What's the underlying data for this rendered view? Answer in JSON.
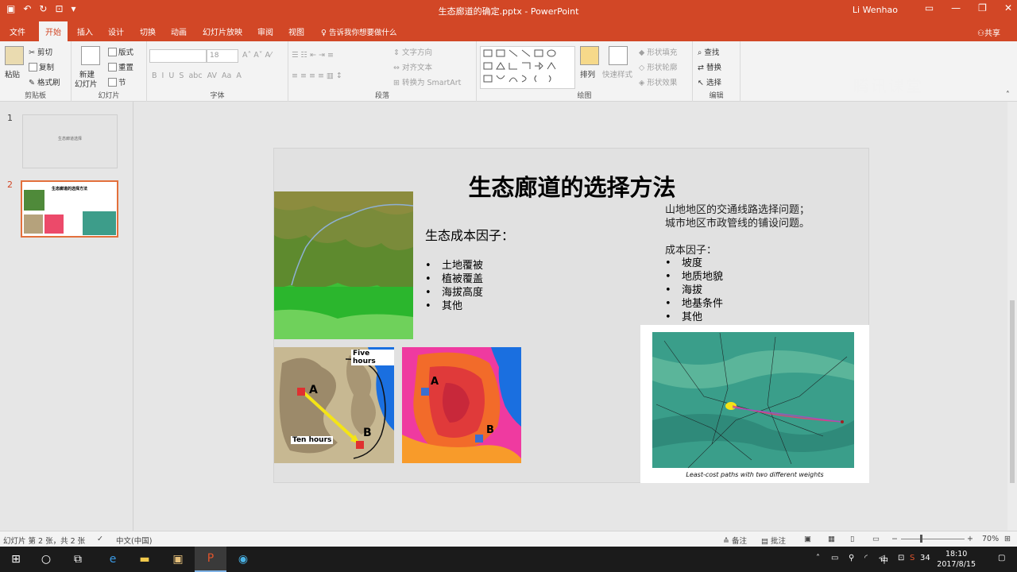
{
  "window": {
    "title": "生态廊道的确定.pptx - PowerPoint",
    "user": "Li Wenhao",
    "watermark": "腾讯课堂"
  },
  "ribbon_tabs": [
    "文件",
    "开始",
    "插入",
    "设计",
    "切换",
    "动画",
    "幻灯片放映",
    "审阅",
    "视图"
  ],
  "tell_me": "告诉我你想要做什么",
  "share": "共享",
  "clipboard": {
    "paste": "粘贴",
    "cut": "剪切",
    "copy": "复制",
    "painter": "格式刷",
    "label": "剪贴板"
  },
  "slides_group": {
    "new": "新建",
    "new2": "幻灯片",
    "layout": "版式",
    "reset": "重置",
    "section": "节",
    "label": "幻灯片"
  },
  "font_group": {
    "size": "18",
    "label": "字体"
  },
  "paragraph_group": {
    "text_dir": "文字方向",
    "align": "对齐文本",
    "smartart": "转换为 SmartArt",
    "label": "段落"
  },
  "drawing_group": {
    "arrange": "排列",
    "quick_styles": "快速样式",
    "fill": "形状填充",
    "outline": "形状轮廓",
    "effect": "形状效果",
    "label": "绘图"
  },
  "editing_group": {
    "find": "查找",
    "replace": "替换",
    "select": "选择",
    "label": "编辑"
  },
  "thumbs": [
    {
      "num": "1",
      "text": "生态廊道选择"
    },
    {
      "num": "2",
      "text": "生态廊道的选择方法"
    }
  ],
  "slide": {
    "title": "生态廊道的选择方法",
    "heading": "生态成本因子：",
    "left_list": [
      "土地覆被",
      "植被覆盖",
      "海拔高度",
      "其他"
    ],
    "right_lines": [
      "山地地区的交通线路选择问题；",
      "城市地区市政管线的铺设问题。"
    ],
    "right_subhead": "成本因子：",
    "right_list": [
      "坡度",
      "地质地貌",
      "海拔",
      "地基条件",
      "其他"
    ],
    "map_labels": {
      "five": "Five hours",
      "ten": "Ten hours",
      "a": "A",
      "b": "B"
    },
    "caption": "Least-cost paths with two different weights"
  },
  "status": {
    "slide_info": "幻灯片 第 2 张，共 2 张",
    "lang": "中文(中国)",
    "notes": "备注",
    "comments": "批注",
    "zoom": "70%"
  },
  "taskbar": {
    "time": "18:10",
    "date": "2017/8/15",
    "ime": "中",
    "temp": "34"
  }
}
